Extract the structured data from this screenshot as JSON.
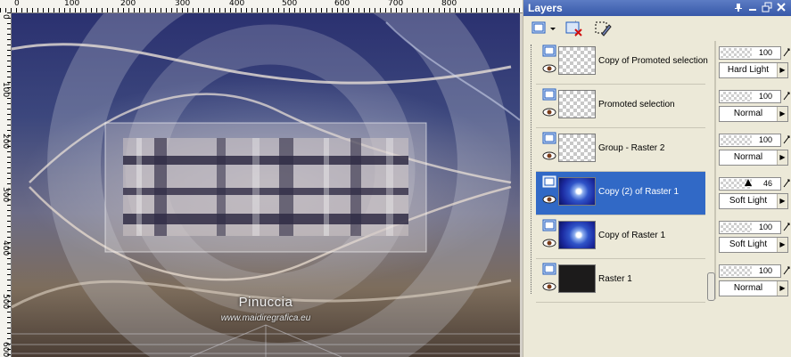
{
  "ruler": {
    "top_labels": [
      "0",
      "100",
      "200",
      "300",
      "400",
      "500",
      "600",
      "700",
      "800"
    ],
    "left_labels": [
      "0",
      "100",
      "200",
      "300",
      "400",
      "500",
      "600"
    ]
  },
  "canvas": {
    "watermark_name": "Pinuccia",
    "watermark_url": "www.maidiregrafica.eu"
  },
  "palette": {
    "title": "Layers",
    "titlebar_buttons": [
      "pin-icon",
      "minimize-icon",
      "restore-icon",
      "close-icon"
    ],
    "toolbar": [
      "new-layer-icon",
      "delete-layer-icon",
      "edit-selection-icon"
    ],
    "layers": [
      {
        "name": "Copy of Promoted selection",
        "thumb": "transparent",
        "opacity": "100",
        "opacity_value": 100,
        "blend": "Hard Light",
        "selected": false
      },
      {
        "name": "Promoted selection",
        "thumb": "transparent",
        "opacity": "100",
        "opacity_value": 100,
        "blend": "Normal",
        "selected": false
      },
      {
        "name": "Group - Raster 2",
        "thumb": "transparent",
        "opacity": "100",
        "opacity_value": 100,
        "blend": "Normal",
        "selected": false
      },
      {
        "name": "Copy (2) of Raster 1",
        "thumb": "swirl",
        "opacity": "46",
        "opacity_value": 46,
        "blend": "Soft Light",
        "selected": true
      },
      {
        "name": "Copy of Raster 1",
        "thumb": "swirl",
        "opacity": "100",
        "opacity_value": 100,
        "blend": "Soft Light",
        "selected": false
      },
      {
        "name": "Raster 1",
        "thumb": "dark",
        "opacity": "100",
        "opacity_value": 100,
        "blend": "Normal",
        "selected": false
      }
    ],
    "colors": {
      "selection": "#3169c6",
      "titlebar": "#3758a8",
      "panel": "#ece9d8"
    }
  }
}
